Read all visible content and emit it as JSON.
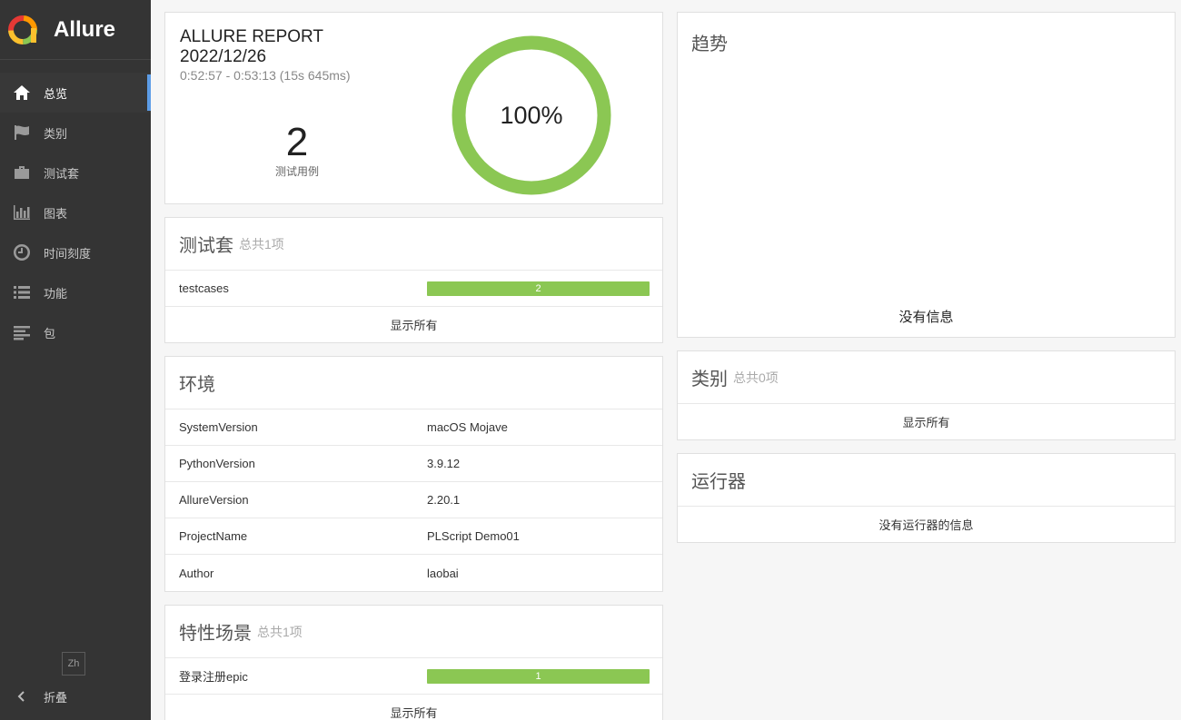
{
  "sidebar": {
    "brand": "Allure",
    "items": [
      {
        "label": "总览",
        "icon": "home-icon"
      },
      {
        "label": "类别",
        "icon": "flag-icon"
      },
      {
        "label": "测试套",
        "icon": "briefcase-icon"
      },
      {
        "label": "图表",
        "icon": "bar-chart-icon"
      },
      {
        "label": "时间刻度",
        "icon": "clock-icon"
      },
      {
        "label": "功能",
        "icon": "list-icon"
      },
      {
        "label": "包",
        "icon": "align-left-icon"
      }
    ],
    "lang": "Zh",
    "collapse_label": "折叠"
  },
  "summary": {
    "title_line1": "ALLURE REPORT",
    "title_line2": "2022/12/26",
    "time_range": "0:52:57 - 0:53:13 (15s 645ms)",
    "count": "2",
    "count_label": "测试用例",
    "percent_label": "100%",
    "pass_fraction": 1.0,
    "pass_color": "#8bc753"
  },
  "suites": {
    "title": "测试套",
    "subtitle": "总共1项",
    "rows": [
      {
        "name": "testcases",
        "count": "2"
      }
    ],
    "show_all": "显示所有"
  },
  "environment": {
    "title": "环境",
    "rows": [
      {
        "key": "SystemVersion",
        "value": "macOS Mojave"
      },
      {
        "key": "PythonVersion",
        "value": "3.9.12"
      },
      {
        "key": "AllureVersion",
        "value": "2.20.1"
      },
      {
        "key": "ProjectName",
        "value": "PLScript Demo01"
      },
      {
        "key": "Author",
        "value": "laobai"
      }
    ]
  },
  "features": {
    "title": "特性场景",
    "subtitle": "总共1项",
    "rows": [
      {
        "name": "登录注册epic",
        "count": "1"
      }
    ],
    "show_all": "显示所有"
  },
  "trend": {
    "title": "趋势",
    "empty": "没有信息"
  },
  "categories": {
    "title": "类别",
    "subtitle": "总共0项",
    "show_all": "显示所有"
  },
  "executors": {
    "title": "运行器",
    "empty": "没有运行器的信息"
  }
}
